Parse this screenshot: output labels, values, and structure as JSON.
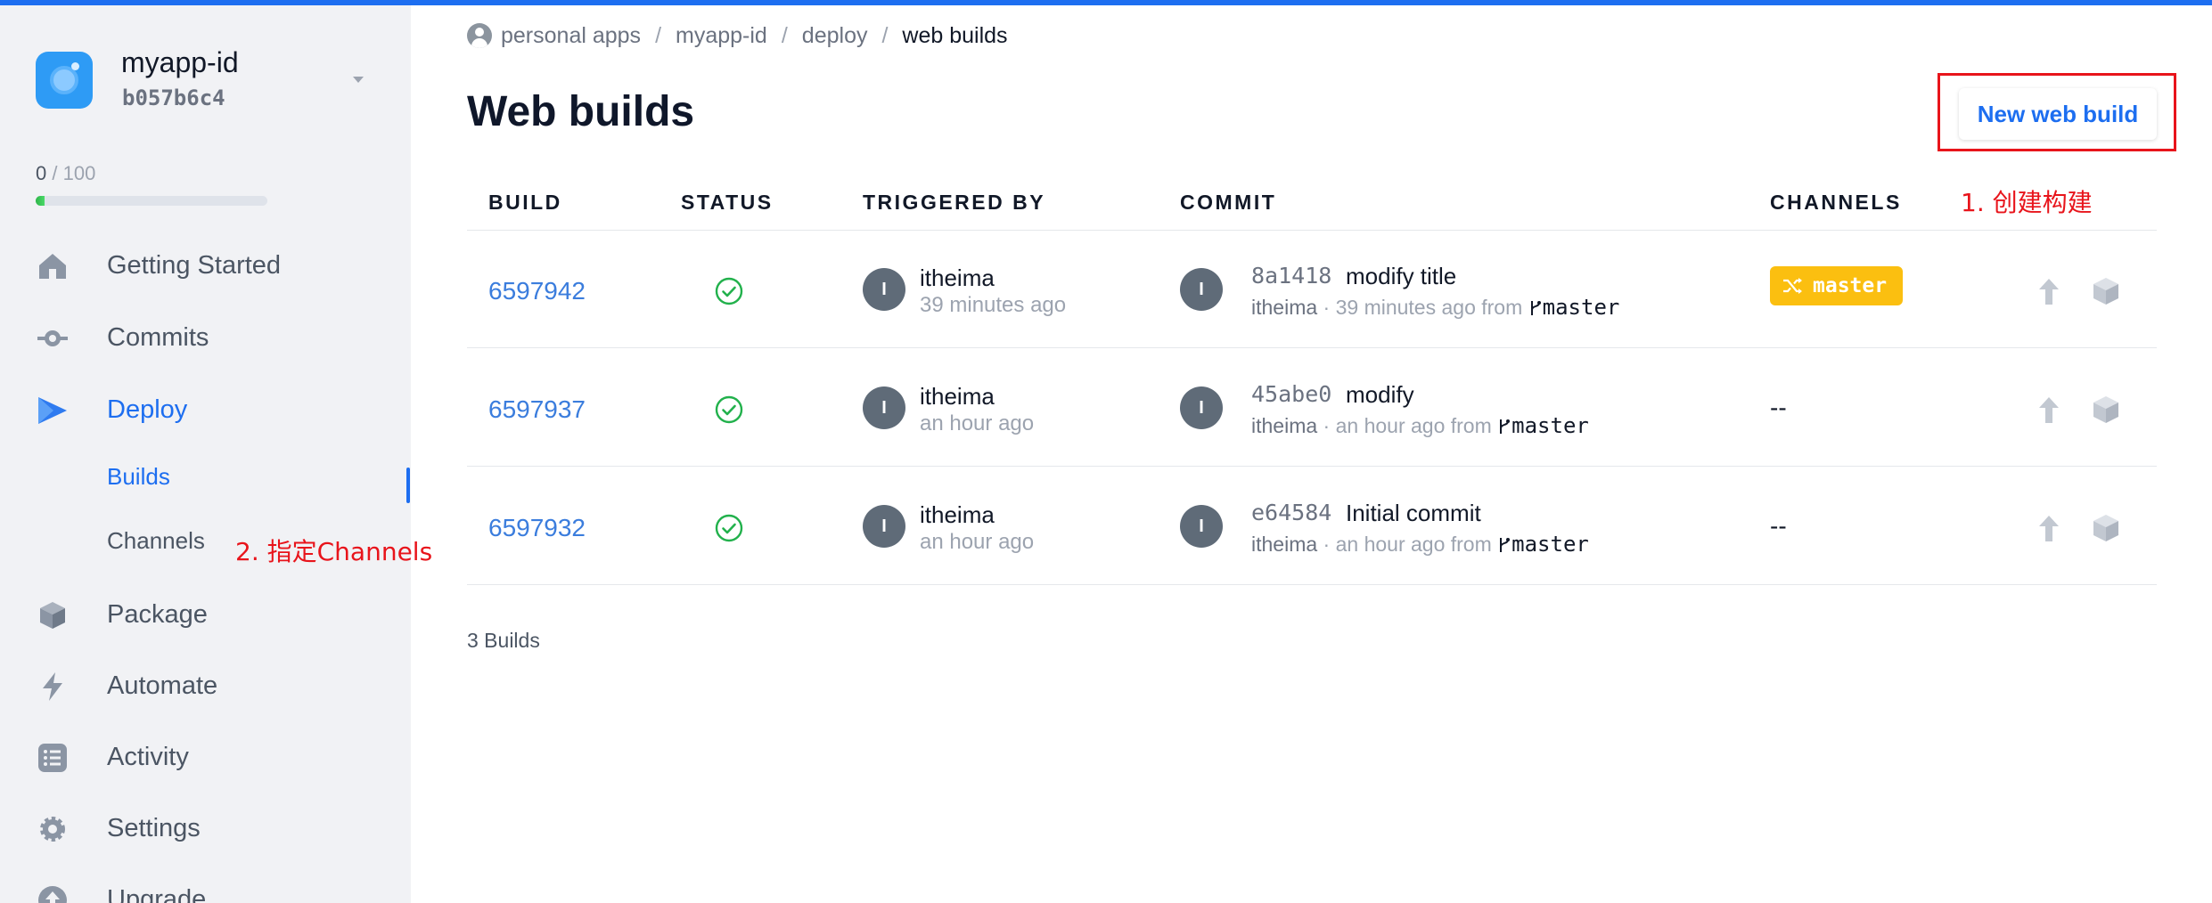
{
  "app": {
    "name": "myapp-id",
    "hash": "b057b6c4"
  },
  "usage": {
    "used": "0",
    "separator": " / ",
    "total": "100",
    "fraction": 0.04
  },
  "nav": {
    "getting_started": "Getting Started",
    "commits": "Commits",
    "deploy": "Deploy",
    "builds": "Builds",
    "channels": "Channels",
    "package": "Package",
    "automate": "Automate",
    "activity": "Activity",
    "settings": "Settings",
    "upgrade": "Upgrade"
  },
  "annotations": {
    "step1": "1. 创建构建",
    "step2": "2. 指定Channels"
  },
  "breadcrumb": {
    "items": [
      "personal apps",
      "myapp-id",
      "deploy"
    ],
    "current": "web builds",
    "separator": "/"
  },
  "page": {
    "title": "Web builds",
    "new_button": "New web build"
  },
  "table": {
    "columns": {
      "build": "BUILD",
      "status": "STATUS",
      "triggered_by": "TRIGGERED BY",
      "commit": "COMMIT",
      "channels": "CHANNELS"
    },
    "rows": [
      {
        "build": "6597942",
        "status": "success",
        "avatar": "I",
        "triggered_by": "itheima",
        "triggered_time": "39 minutes ago",
        "commit_avatar": "I",
        "commit_hash": "8a1418",
        "commit_message": "modify title",
        "commit_author": "itheima",
        "commit_time": " · 39 minutes ago from ",
        "branch": "master",
        "channel": "master"
      },
      {
        "build": "6597937",
        "status": "success",
        "avatar": "I",
        "triggered_by": "itheima",
        "triggered_time": "an hour ago",
        "commit_avatar": "I",
        "commit_hash": "45abe0",
        "commit_message": "modify",
        "commit_author": "itheima",
        "commit_time": " · an hour ago from ",
        "branch": "master",
        "channel": "--"
      },
      {
        "build": "6597932",
        "status": "success",
        "avatar": "I",
        "triggered_by": "itheima",
        "triggered_time": "an hour ago",
        "commit_avatar": "I",
        "commit_hash": "e64584",
        "commit_message": "Initial commit",
        "commit_author": "itheima",
        "commit_time": " · an hour ago from ",
        "branch": "master",
        "channel": "--"
      }
    ],
    "footer": "3 Builds"
  },
  "colors": {
    "accent": "#1d6ef0",
    "success": "#22b14c",
    "channel_badge": "#fbbf10",
    "annotation": "#e8141b"
  },
  "icons": [
    "home-icon",
    "commit-icon",
    "deploy-icon",
    "package-icon",
    "automate-icon",
    "activity-icon",
    "settings-icon",
    "upgrade-icon",
    "check-circle-icon",
    "deploy-arrow-icon",
    "box-icon",
    "shuffle-icon",
    "branch-icon"
  ]
}
